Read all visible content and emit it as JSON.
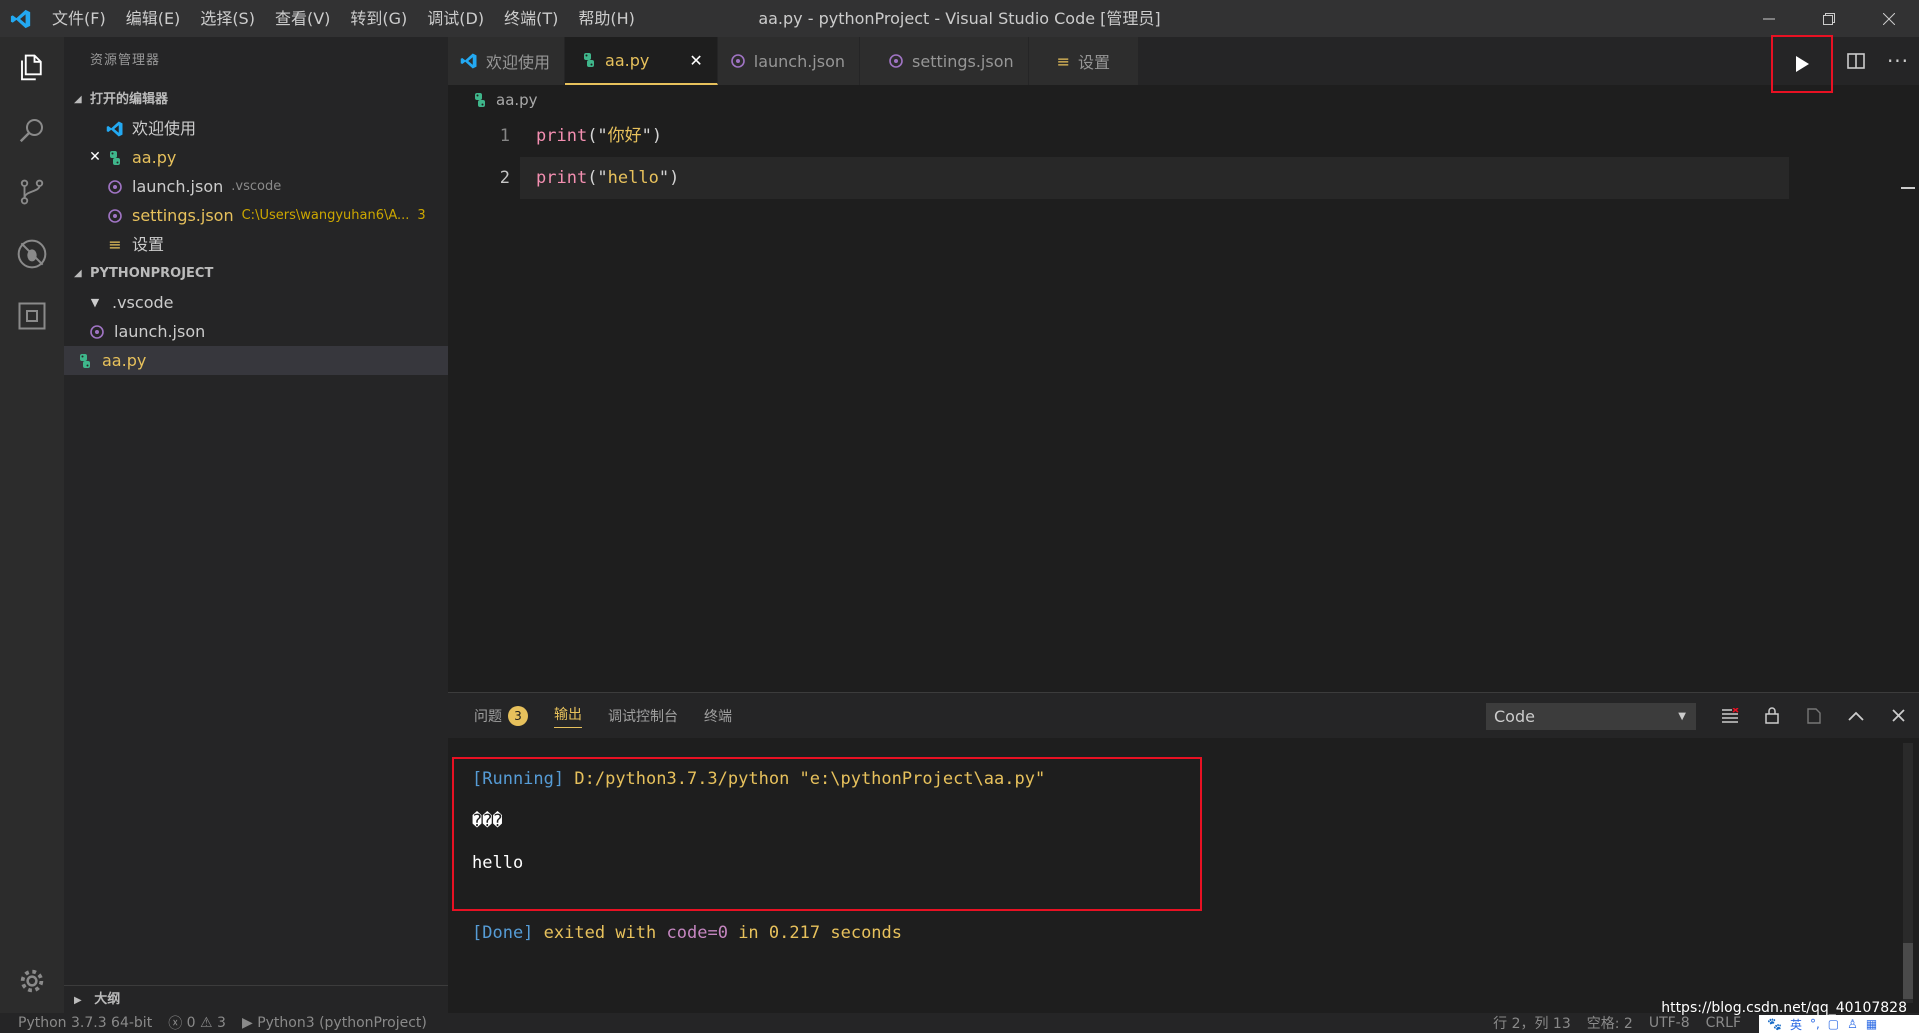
{
  "titlebar": {
    "menus": [
      "文件(F)",
      "编辑(E)",
      "选择(S)",
      "查看(V)",
      "转到(G)",
      "调试(D)",
      "终端(T)",
      "帮助(H)"
    ],
    "window_title": "aa.py - pythonProject - Visual Studio Code [管理员]"
  },
  "sidebar": {
    "title": "资源管理器",
    "open_editors_header": "打开的编辑器",
    "open_editors": [
      {
        "label": "欢迎使用",
        "desc": ""
      },
      {
        "label": "aa.py",
        "desc": ""
      },
      {
        "label": "launch.json",
        "desc": ".vscode"
      },
      {
        "label": "settings.json",
        "desc": "C:\\Users\\wangyuhan6\\A...",
        "count": "3"
      },
      {
        "label": "设置",
        "desc": ""
      }
    ],
    "project_header": "PYTHONPROJECT",
    "tree": [
      {
        "label": ".vscode"
      },
      {
        "label": "launch.json"
      },
      {
        "label": "aa.py"
      }
    ],
    "outline_header": "大纲"
  },
  "tabs": [
    {
      "label": "欢迎使用"
    },
    {
      "label": "aa.py"
    },
    {
      "label": "launch.json"
    },
    {
      "label": "settings.json"
    },
    {
      "label": "设置"
    }
  ],
  "breadcrumb": "aa.py",
  "code": {
    "lines": [
      {
        "num": "1",
        "fn": "print",
        "open": "(\"",
        "str": "你好",
        "close": "\")"
      },
      {
        "num": "2",
        "fn": "print",
        "open": "(\"",
        "str": "hello",
        "close": "\")"
      }
    ]
  },
  "panel": {
    "tabs": [
      {
        "label": "问题",
        "badge": "3"
      },
      {
        "label": "输出"
      },
      {
        "label": "调试控制台"
      },
      {
        "label": "终端"
      }
    ],
    "select_value": "Code",
    "output": {
      "running_tag": "[Running]",
      "command": "D:/python3.7.3/python \"e:\\pythonProject\\aa.py\"",
      "garbled": "���",
      "hello": "hello",
      "done_tag": "[Done]",
      "exited_with": "exited with",
      "code": "code=0",
      "in_word": "in",
      "seconds_value": "0.217",
      "seconds_word": "seconds"
    }
  },
  "statusbar": {
    "interpreter": "Python 3.7.3 64-bit",
    "errors": "0",
    "warnings": "3",
    "runner": "Python3 (pythonProject)",
    "position": "行 2，列 13",
    "spaces": "空格: 2",
    "encoding": "UTF-8",
    "eol": "CRLF"
  },
  "watermark": "https://blog.csdn.net/qq_40107828",
  "ime_label": "英",
  "colors": {
    "accent": "#e7c15c",
    "highlight_box": "#e81123",
    "vscode_blue": "#23a9f2"
  }
}
